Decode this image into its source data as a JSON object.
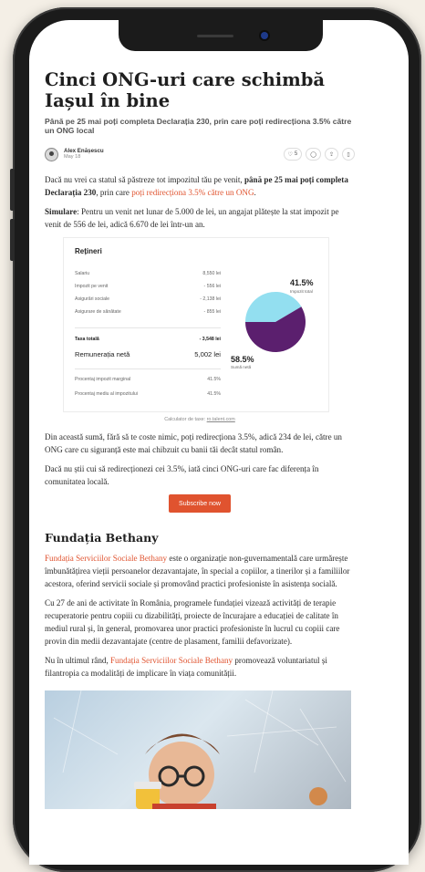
{
  "article": {
    "title": "Cinci ONG-uri care schimbă Iașul în bine",
    "subtitle": "Până pe 25 mai poți completa Declarația 230, prin care poți redirecționa 3.5% către un ONG local",
    "author": "Alex Enășescu",
    "date": "May 18",
    "likes": "5",
    "p1_pre": "Dacă nu vrei ca statul să păstreze tot impozitul tău pe venit, ",
    "p1_bold": "până pe 25 mai poți completa Declarația 230",
    "p1_mid": ", prin care ",
    "p1_link": "poți redirecționa 3.5% către un ONG",
    "p1_end": ".",
    "p2_bold": "Simulare",
    "p2_text": ": Pentru un venit net lunar de 5.000 de lei, un angajat plătește la stat impozit pe venit de 556 de lei, adică 6.670 de lei într-un an.",
    "caption_pre": "Calculator de taxe: ",
    "caption_link": "ro.talent.com",
    "p3": "Din această sumă, fără să te coste nimic, poți redirecționa 3.5%, adică 234 de lei, către un ONG care cu siguranță este mai chibzuit cu banii tăi decât statul român.",
    "p4": "Dacă nu știi cui să redirecționezi cei 3.5%, iată cinci ONG-uri care fac diferența în comunitatea locală.",
    "subscribe": "Subscribe now",
    "h2": "Fundația Bethany",
    "p5_link": "Fundația Serviciilor Sociale Bethany",
    "p5_text": " este o organizație non-guvernamentală care urmărește îmbunătățirea vieții persoanelor dezavantajate, în special a copiilor, a tinerilor și a familiilor acestora, oferind servicii sociale și promovând practici profesioniste în asistența socială.",
    "p6": "Cu 27 de ani de activitate în România, programele fundației vizează activități de terapie recuperatorie pentru copiii cu dizabilități, proiecte de încurajare a educației de calitate în mediul rural și, în general, promovarea unor practici profesioniste în lucrul cu copiii care provin din medii dezavantajate (centre de plasament, familii defavorizate).",
    "p7_pre": "Nu în ultimul rând, ",
    "p7_link": "Fundația Serviciilor Sociale Bethany",
    "p7_end": " promovează voluntariatul și filantropia ca modalități de implicare în viața comunității."
  },
  "calculator": {
    "title": "Rețineri",
    "rows": [
      {
        "label": "Salariu",
        "value": "8,550 lei"
      },
      {
        "label": "Impozit pe venit",
        "value": "- 556 lei"
      },
      {
        "label": "Asigurări sociale",
        "value": "- 2,138 lei"
      },
      {
        "label": "Asigurare de sănătate",
        "value": "- 855 lei"
      },
      {
        "label": "Taxa totală",
        "value": "- 3,548 lei"
      },
      {
        "label": "Remunerația netă",
        "value": "5,002 lei"
      },
      {
        "label": "Procentaj impozit marginal",
        "value": "41.5%"
      },
      {
        "label": "Procentaj mediu al impozitului",
        "value": "41.5%"
      }
    ]
  },
  "chart_data": {
    "type": "pie",
    "slices": [
      {
        "label": "Impozit total",
        "value": 41.5,
        "color": "#93dff0"
      },
      {
        "label": "Sumă netă",
        "value": 58.5,
        "color": "#5b1f6e"
      }
    ],
    "labels": [
      "41.5%",
      "58.5%"
    ]
  }
}
